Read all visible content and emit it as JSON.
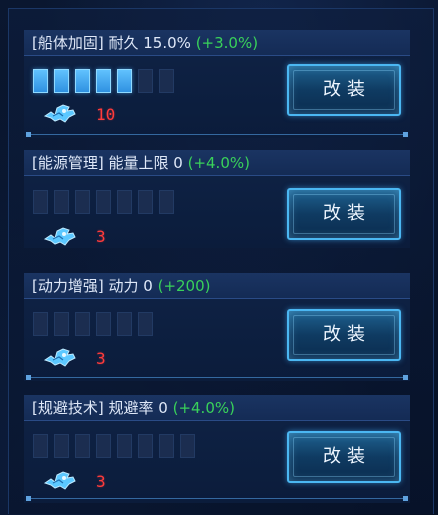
{
  "modules": [
    {
      "category": "[船体加固]",
      "stat": "耐久 15.0%",
      "bonus": "(+3.0%)",
      "segments_total": 7,
      "segments_filled": 5,
      "part_count": "10",
      "button_label": "改装"
    },
    {
      "category": "[能源管理]",
      "stat": "能量上限 0",
      "bonus": "(+4.0%)",
      "segments_total": 7,
      "segments_filled": 0,
      "part_count": "3",
      "button_label": "改装"
    },
    {
      "category": "[动力增强]",
      "stat": "动力 0",
      "bonus": "(+200)",
      "segments_total": 6,
      "segments_filled": 0,
      "part_count": "3",
      "button_label": "改装"
    },
    {
      "category": "[规避技术]",
      "stat": "规避率 0",
      "bonus": "(+4.0%)",
      "segments_total": 8,
      "segments_filled": 0,
      "part_count": "3",
      "button_label": "改装"
    }
  ],
  "colors": {
    "bonus": "#39d15a",
    "count": "#ff3b3b",
    "segment_filled": "#4aaaf2",
    "segment_empty": "#1b2d50",
    "button_border": "#4bb7f2"
  },
  "icons": {
    "part": "blueprint-part-icon"
  }
}
